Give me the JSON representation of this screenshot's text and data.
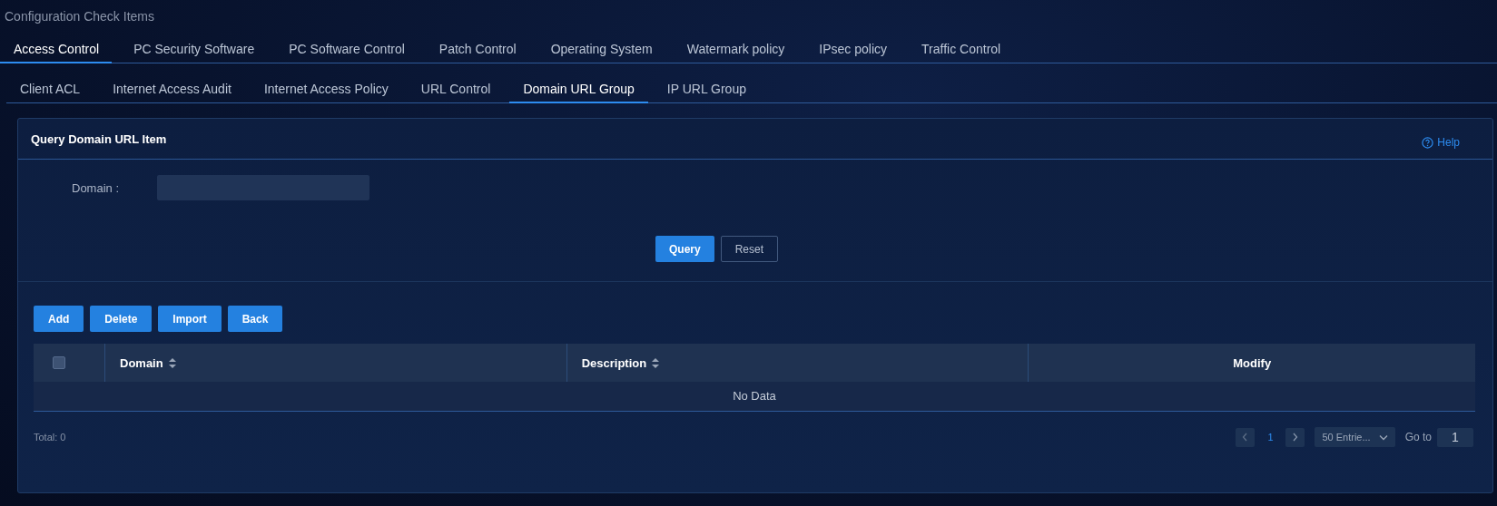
{
  "page_title": "Configuration Check Items",
  "tabs": [
    {
      "label": "Access Control",
      "selected": true
    },
    {
      "label": "PC Security Software",
      "selected": false
    },
    {
      "label": "PC Software Control",
      "selected": false
    },
    {
      "label": "Patch Control",
      "selected": false
    },
    {
      "label": "Operating System",
      "selected": false
    },
    {
      "label": "Watermark policy",
      "selected": false
    },
    {
      "label": "IPsec policy",
      "selected": false
    },
    {
      "label": "Traffic Control",
      "selected": false
    }
  ],
  "subtabs": [
    {
      "label": "Client ACL",
      "selected": false
    },
    {
      "label": "Internet Access Audit",
      "selected": false
    },
    {
      "label": "Internet Access Policy",
      "selected": false
    },
    {
      "label": "URL Control",
      "selected": false
    },
    {
      "label": "Domain URL Group",
      "selected": true
    },
    {
      "label": "IP URL Group",
      "selected": false
    }
  ],
  "query_panel": {
    "title": "Query Domain URL Item",
    "help": "Help",
    "field_label": "Domain :",
    "buttons": [
      {
        "label": "Query",
        "kind": "primary"
      },
      {
        "label": "Reset",
        "kind": "secondary"
      }
    ]
  },
  "actions": [
    "Add",
    "Delete",
    "Import",
    "Back"
  ],
  "table": {
    "select_all": {
      "checked": false
    },
    "columns": [
      {
        "label": "Domain",
        "sortable": true,
        "kind": "data"
      },
      {
        "label": "Description",
        "sortable": true,
        "kind": "data"
      },
      {
        "label": "Modify",
        "sortable": false,
        "kind": "action"
      }
    ],
    "empty_text": "No Data"
  },
  "footer": {
    "total": "Total: 0",
    "pages": [
      {
        "label": "1",
        "selected": true
      }
    ],
    "page_size": "50 Entrie...",
    "goto_label": "Go to",
    "goto_value": "1"
  }
}
